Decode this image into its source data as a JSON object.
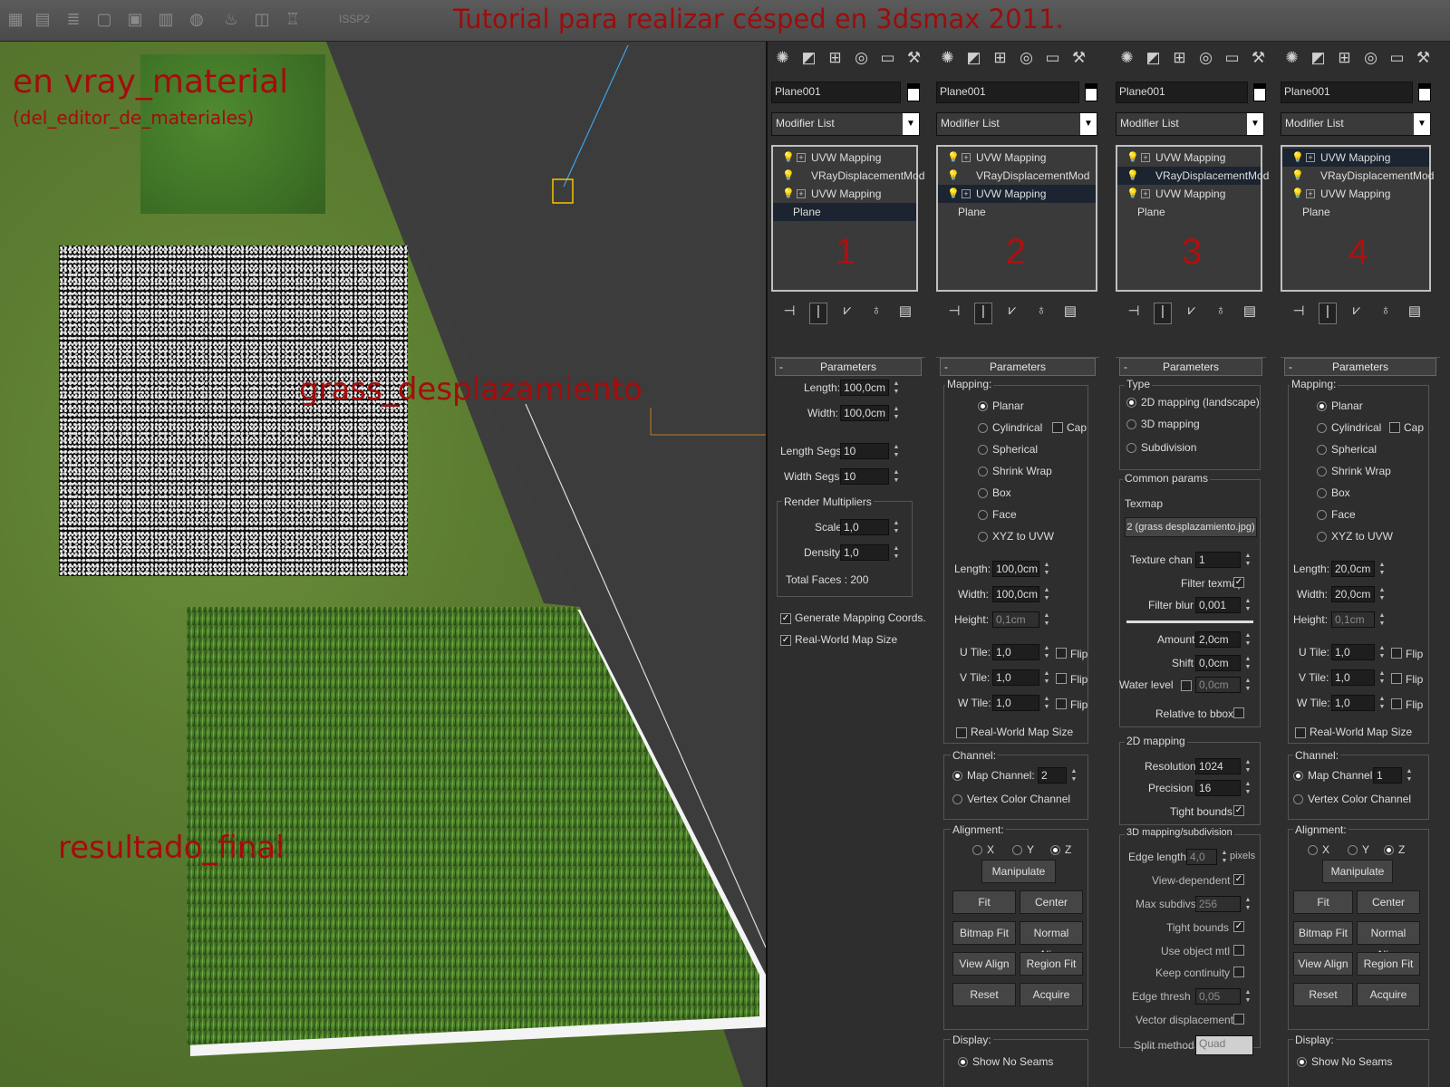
{
  "title": "Tutorial para realizar césped en 3dsmax 2011.",
  "toolbar": {
    "icons": [
      "grid-icon",
      "layer-icon",
      "list-icon",
      "window-icon",
      "image-icon",
      "save-icon",
      "globe-icon",
      "teapot-icon",
      "render-icon",
      "kettle-icon"
    ],
    "label": "ISSP2"
  },
  "viewport": {
    "label_vray": "en vray_material",
    "label_editor": "(del_editor_de_materiales)",
    "label_displacement": "grass_desplazamiento",
    "label_final": "resultado_final"
  },
  "panels": [
    {
      "object_name": "Plane001",
      "modifier_list": "Modifier List",
      "stack": [
        "UVW Mapping",
        "VRayDisplacementMod",
        "UVW Mapping",
        "Plane"
      ],
      "selected": 3,
      "number": "1",
      "rollout_title": "Parameters",
      "plane": {
        "length_label": "Length:",
        "length": "100,0cm",
        "width_label": "Width:",
        "width": "100,0cm",
        "lsegs_label": "Length Segs:",
        "lsegs": "10",
        "wsegs_label": "Width Segs:",
        "wsegs": "10",
        "render_mult": "Render Multipliers",
        "scale_label": "Scale:",
        "scale": "1,0",
        "density_label": "Density:",
        "density": "1,0",
        "total_faces": "Total Faces : 200",
        "gen_map": "Generate Mapping Coords.",
        "real_world": "Real-World Map Size"
      }
    },
    {
      "object_name": "Plane001",
      "modifier_list": "Modifier List",
      "stack": [
        "UVW Mapping",
        "VRayDisplacementMod",
        "UVW Mapping",
        "Plane"
      ],
      "selected": 2,
      "number": "2",
      "rollout_title": "Parameters",
      "uvw": {
        "mapping": "Mapping:",
        "types": [
          "Planar",
          "Cylindrical",
          "Spherical",
          "Shrink Wrap",
          "Box",
          "Face",
          "XYZ to UVW"
        ],
        "cap": "Cap",
        "length_label": "Length:",
        "length": "100,0cm",
        "width_label": "Width:",
        "width": "100,0cm",
        "height_label": "Height:",
        "height": "0,1cm",
        "utile_label": "U Tile:",
        "utile": "1,0",
        "vtile_label": "V Tile:",
        "vtile": "1,0",
        "wtile_label": "W Tile:",
        "wtile": "1,0",
        "flip": "Flip",
        "real_world": "Real-World Map Size",
        "channel": "Channel:",
        "map_channel_label": "Map Channel:",
        "map_channel": "2",
        "vertex_color": "Vertex Color Channel",
        "alignment": "Alignment:",
        "x": "X",
        "y": "Y",
        "z": "Z",
        "manipulate": "Manipulate",
        "fit": "Fit",
        "center": "Center",
        "bitmap_fit": "Bitmap Fit",
        "normal_align": "Normal Align",
        "view_align": "View Align",
        "region_fit": "Region Fit",
        "reset": "Reset",
        "acquire": "Acquire",
        "display": "Display:",
        "show_no_seams": "Show No Seams"
      }
    },
    {
      "object_name": "Plane001",
      "modifier_list": "Modifier List",
      "stack": [
        "UVW Mapping",
        "VRayDisplacementMod",
        "UVW Mapping",
        "Plane"
      ],
      "selected": 1,
      "number": "3",
      "rollout_title": "Parameters",
      "disp": {
        "type": "Type",
        "t2d": "2D mapping (landscape)",
        "t3d": "3D mapping",
        "tsub": "Subdivision",
        "common": "Common params",
        "texmap": "Texmap",
        "texmap_value": "2 (grass desplazamiento.jpg)",
        "texchan_label": "Texture chan",
        "texchan": "1",
        "filter_texmap": "Filter texmap",
        "filter_blur_label": "Filter blur",
        "filter_blur": "0,001",
        "amount_label": "Amount",
        "amount": "2,0cm",
        "shift_label": "Shift",
        "shift": "0,0cm",
        "water_label": "Water level",
        "water": "0,0cm",
        "rel_bbox": "Relative to bbox",
        "map2d": "2D mapping",
        "res_label": "Resolution",
        "res": "1024",
        "prec_label": "Precision",
        "prec": "16",
        "tight": "Tight bounds",
        "map3d": "3D mapping/subdivision",
        "edge_label": "Edge length",
        "edge": "4,0",
        "pixels": "pixels",
        "view_dep": "View-dependent",
        "max_subdivs_label": "Max subdivs",
        "max_subdivs": "256",
        "tight2": "Tight bounds",
        "use_obj": "Use object mtl",
        "keep_cont": "Keep continuity",
        "edge_thresh_label": "Edge thresh",
        "edge_thresh": "0,05",
        "vector_disp": "Vector displacement",
        "split_label": "Split method",
        "split": "Quad"
      }
    },
    {
      "object_name": "Plane001",
      "modifier_list": "Modifier List",
      "stack": [
        "UVW Mapping",
        "VRayDisplacementMod",
        "UVW Mapping",
        "Plane"
      ],
      "selected": 0,
      "number": "4",
      "rollout_title": "Parameters",
      "uvw": {
        "mapping": "Mapping:",
        "types": [
          "Planar",
          "Cylindrical",
          "Spherical",
          "Shrink Wrap",
          "Box",
          "Face",
          "XYZ to UVW"
        ],
        "cap": "Cap",
        "length_label": "Length:",
        "length": "20,0cm",
        "width_label": "Width:",
        "width": "20,0cm",
        "height_label": "Height:",
        "height": "0,1cm",
        "utile_label": "U Tile:",
        "utile": "1,0",
        "vtile_label": "V Tile:",
        "vtile": "1,0",
        "wtile_label": "W Tile:",
        "wtile": "1,0",
        "flip": "Flip",
        "real_world": "Real-World Map Size",
        "channel": "Channel:",
        "map_channel_label": "Map Channel:",
        "map_channel": "1",
        "vertex_color": "Vertex Color Channel",
        "alignment": "Alignment:",
        "x": "X",
        "y": "Y",
        "z": "Z",
        "manipulate": "Manipulate",
        "fit": "Fit",
        "center": "Center",
        "bitmap_fit": "Bitmap Fit",
        "normal_align": "Normal Align",
        "view_align": "View Align",
        "region_fit": "Region Fit",
        "reset": "Reset",
        "acquire": "Acquire",
        "display": "Display:",
        "show_no_seams": "Show No Seams"
      }
    }
  ],
  "colors": {
    "title_red": "#9b0d0d",
    "number_red": "#b10f0f",
    "panel_bg": "#2e2e2e",
    "selected_row": "#1b2430"
  }
}
